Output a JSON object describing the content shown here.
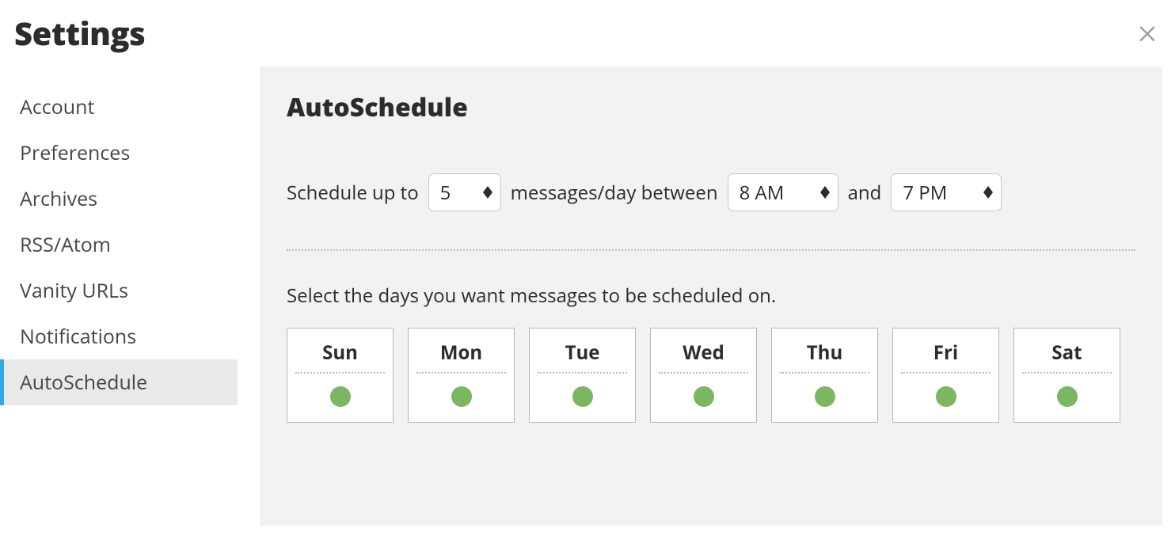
{
  "page": {
    "title": "Settings"
  },
  "sidebar": {
    "items": [
      {
        "label": "Account",
        "active": false
      },
      {
        "label": "Preferences",
        "active": false
      },
      {
        "label": "Archives",
        "active": false
      },
      {
        "label": "RSS/Atom",
        "active": false
      },
      {
        "label": "Vanity URLs",
        "active": false
      },
      {
        "label": "Notifications",
        "active": false
      },
      {
        "label": "AutoSchedule",
        "active": true
      }
    ]
  },
  "panel": {
    "title": "AutoSchedule",
    "schedule": {
      "text_prefix": "Schedule up to",
      "count_value": "5",
      "text_mid": "messages/day between",
      "start_value": "8 AM",
      "text_and": "and",
      "end_value": "7 PM"
    },
    "instruction": "Select the days you want messages to be scheduled on.",
    "days": [
      {
        "label": "Sun",
        "selected": true
      },
      {
        "label": "Mon",
        "selected": true
      },
      {
        "label": "Tue",
        "selected": true
      },
      {
        "label": "Wed",
        "selected": true
      },
      {
        "label": "Thu",
        "selected": true
      },
      {
        "label": "Fri",
        "selected": true
      },
      {
        "label": "Sat",
        "selected": true
      }
    ]
  },
  "colors": {
    "accent_blue": "#2fa9e6",
    "dot_green": "#7bb661",
    "panel_bg": "#f2f2f2"
  }
}
